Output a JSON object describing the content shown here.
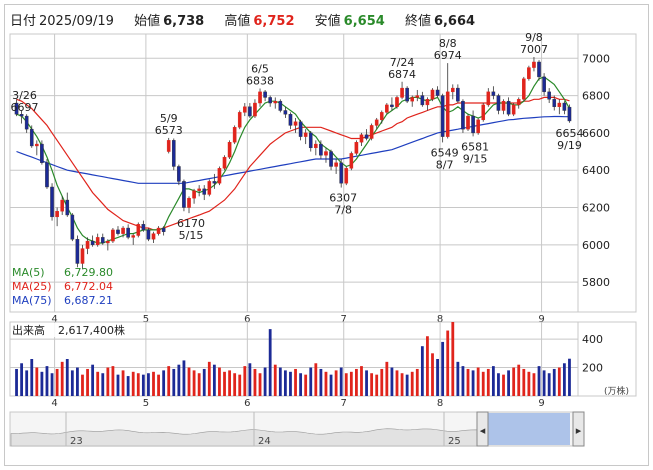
{
  "header": {
    "date_label": "日付",
    "date": "2025/09/19",
    "open_label": "始値",
    "open": "6,738",
    "high_label": "高値",
    "high": "6,752",
    "low_label": "安値",
    "low": "6,654",
    "close_label": "終値",
    "close": "6,664"
  },
  "colors": {
    "up": "#e0241c",
    "down": "#1c2a96",
    "ma5": "#2a8a2a",
    "ma25": "#e0241c",
    "ma75": "#1f3fbf",
    "grid": "#c8c8c8",
    "volume_up": "#e0241c",
    "volume_down": "#1c2a96",
    "navigator_fill": "#9bb7e6"
  },
  "chart_data": [
    {
      "type": "candlestick",
      "y_ticks": [
        5800,
        6000,
        6200,
        6400,
        6600,
        6800,
        7000
      ],
      "ylim": [
        5640,
        7130
      ],
      "month_labels": [
        "4",
        "5",
        "6",
        "7",
        "8",
        "9"
      ],
      "legend": [
        {
          "name": "MA(5)",
          "value": "6,729.80"
        },
        {
          "name": "MA(25)",
          "value": "6,772.04"
        },
        {
          "name": "MA(75)",
          "value": "6,687.21"
        }
      ],
      "annotations": [
        {
          "date": "3/26",
          "value": "6697",
          "kind": "high"
        },
        {
          "date": "5/9",
          "value": "6573",
          "kind": "high"
        },
        {
          "date": "6/5",
          "value": "6838",
          "kind": "high"
        },
        {
          "date": "7/24",
          "value": "6874",
          "kind": "high"
        },
        {
          "date": "8/8",
          "value": "6974",
          "kind": "high"
        },
        {
          "date": "9/8",
          "value": "7007",
          "kind": "high"
        },
        {
          "date": "5/15",
          "value": "6170",
          "kind": "low"
        },
        {
          "date": "7/8",
          "value": "6307",
          "kind": "low"
        },
        {
          "date": "8/7",
          "value": "6549",
          "kind": "low"
        },
        {
          "date": "9/15",
          "value": "6581",
          "kind": "low"
        },
        {
          "date": "9/19",
          "value": "6654",
          "kind": "low"
        }
      ],
      "ohlc": [
        [
          6760,
          6780,
          6690,
          6700
        ],
        [
          6700,
          6720,
          6650,
          6690
        ],
        [
          6690,
          6700,
          6600,
          6620
        ],
        [
          6620,
          6640,
          6520,
          6530
        ],
        [
          6530,
          6560,
          6480,
          6540
        ],
        [
          6540,
          6560,
          6430,
          6440
        ],
        [
          6440,
          6460,
          6300,
          6310
        ],
        [
          6310,
          6330,
          6130,
          6150
        ],
        [
          6150,
          6200,
          6100,
          6180
        ],
        [
          6180,
          6260,
          6160,
          6240
        ],
        [
          6240,
          6280,
          6150,
          6160
        ],
        [
          6160,
          6170,
          6020,
          6030
        ],
        [
          6030,
          6050,
          5880,
          5900
        ],
        [
          5900,
          6000,
          5870,
          5980
        ],
        [
          5980,
          6040,
          5950,
          6020
        ],
        [
          6020,
          6050,
          5990,
          6000
        ],
        [
          6000,
          6060,
          5990,
          6040
        ],
        [
          6040,
          6060,
          6000,
          6010
        ],
        [
          6010,
          6030,
          5970,
          6020
        ],
        [
          6020,
          6090,
          6010,
          6080
        ],
        [
          6080,
          6100,
          6050,
          6060
        ],
        [
          6060,
          6100,
          6040,
          6090
        ],
        [
          6090,
          6110,
          6030,
          6040
        ],
        [
          6040,
          6060,
          6000,
          6050
        ],
        [
          6050,
          6120,
          6040,
          6110
        ],
        [
          6110,
          6130,
          6070,
          6080
        ],
        [
          6080,
          6090,
          6020,
          6030
        ],
        [
          6030,
          6070,
          6010,
          6060
        ],
        [
          6060,
          6100,
          6050,
          6090
        ],
        [
          6090,
          6100,
          6050,
          6070
        ],
        [
          6500,
          6573,
          6490,
          6560
        ],
        [
          6560,
          6570,
          6400,
          6420
        ],
        [
          6420,
          6430,
          6320,
          6340
        ],
        [
          6340,
          6350,
          6180,
          6200
        ],
        [
          6200,
          6260,
          6170,
          6250
        ],
        [
          6250,
          6300,
          6220,
          6290
        ],
        [
          6290,
          6320,
          6260,
          6300
        ],
        [
          6300,
          6320,
          6240,
          6270
        ],
        [
          6270,
          6350,
          6260,
          6340
        ],
        [
          6340,
          6380,
          6300,
          6330
        ],
        [
          6330,
          6420,
          6320,
          6410
        ],
        [
          6410,
          6480,
          6400,
          6470
        ],
        [
          6470,
          6560,
          6460,
          6550
        ],
        [
          6550,
          6640,
          6540,
          6630
        ],
        [
          6630,
          6720,
          6620,
          6710
        ],
        [
          6710,
          6760,
          6690,
          6740
        ],
        [
          6740,
          6760,
          6680,
          6690
        ],
        [
          6690,
          6780,
          6680,
          6760
        ],
        [
          6760,
          6838,
          6740,
          6820
        ],
        [
          6820,
          6830,
          6770,
          6790
        ],
        [
          6790,
          6800,
          6740,
          6760
        ],
        [
          6760,
          6790,
          6730,
          6770
        ],
        [
          6770,
          6780,
          6710,
          6720
        ],
        [
          6720,
          6740,
          6680,
          6700
        ],
        [
          6700,
          6710,
          6620,
          6640
        ],
        [
          6640,
          6680,
          6600,
          6660
        ],
        [
          6660,
          6670,
          6560,
          6580
        ],
        [
          6580,
          6620,
          6540,
          6600
        ],
        [
          6600,
          6610,
          6500,
          6520
        ],
        [
          6520,
          6560,
          6480,
          6540
        ],
        [
          6540,
          6560,
          6460,
          6480
        ],
        [
          6480,
          6520,
          6440,
          6500
        ],
        [
          6500,
          6510,
          6400,
          6420
        ],
        [
          6420,
          6460,
          6380,
          6440
        ],
        [
          6440,
          6460,
          6307,
          6330
        ],
        [
          6330,
          6420,
          6320,
          6410
        ],
        [
          6410,
          6500,
          6400,
          6490
        ],
        [
          6490,
          6560,
          6480,
          6550
        ],
        [
          6550,
          6600,
          6530,
          6590
        ],
        [
          6590,
          6620,
          6560,
          6570
        ],
        [
          6570,
          6650,
          6560,
          6640
        ],
        [
          6640,
          6680,
          6620,
          6670
        ],
        [
          6670,
          6720,
          6650,
          6710
        ],
        [
          6710,
          6760,
          6700,
          6750
        ],
        [
          6750,
          6790,
          6720,
          6740
        ],
        [
          6740,
          6800,
          6730,
          6790
        ],
        [
          6790,
          6874,
          6780,
          6840
        ],
        [
          6840,
          6850,
          6760,
          6770
        ],
        [
          6770,
          6800,
          6740,
          6790
        ],
        [
          6790,
          6830,
          6770,
          6800
        ],
        [
          6800,
          6820,
          6740,
          6750
        ],
        [
          6750,
          6790,
          6720,
          6780
        ],
        [
          6780,
          6840,
          6770,
          6830
        ],
        [
          6830,
          6850,
          6790,
          6800
        ],
        [
          6800,
          6810,
          6549,
          6580
        ],
        [
          6580,
          6974,
          6570,
          6820
        ],
        [
          6820,
          6860,
          6780,
          6840
        ],
        [
          6840,
          6860,
          6760,
          6770
        ],
        [
          6770,
          6780,
          6600,
          6620
        ],
        [
          6620,
          6700,
          6610,
          6690
        ],
        [
          6690,
          6720,
          6581,
          6600
        ],
        [
          6600,
          6680,
          6590,
          6670
        ],
        [
          6670,
          6760,
          6660,
          6750
        ],
        [
          6750,
          6840,
          6740,
          6820
        ],
        [
          6820,
          6850,
          6780,
          6800
        ],
        [
          6800,
          6810,
          6700,
          6720
        ],
        [
          6720,
          6780,
          6700,
          6770
        ],
        [
          6770,
          6790,
          6690,
          6700
        ],
        [
          6700,
          6760,
          6690,
          6750
        ],
        [
          6750,
          6790,
          6730,
          6780
        ],
        [
          6780,
          6900,
          6770,
          6890
        ],
        [
          6890,
          6960,
          6880,
          6950
        ],
        [
          6950,
          7007,
          6930,
          6980
        ],
        [
          6980,
          6990,
          6880,
          6900
        ],
        [
          6900,
          6920,
          6800,
          6820
        ],
        [
          6820,
          6840,
          6760,
          6780
        ],
        [
          6780,
          6800,
          6720,
          6740
        ],
        [
          6740,
          6780,
          6700,
          6760
        ],
        [
          6760,
          6770,
          6700,
          6720
        ],
        [
          6738,
          6752,
          6654,
          6664
        ]
      ],
      "ma5": [
        6700,
        6690,
        6660,
        6620,
        6580,
        6530,
        6470,
        6400,
        6320,
        6260,
        6200,
        6150,
        6090,
        6050,
        6030,
        6020,
        6010,
        6010,
        6020,
        6030,
        6040,
        6050,
        6060,
        6060,
        6070,
        6080,
        6080,
        6080,
        6080,
        6090,
        6150,
        6200,
        6250,
        6300,
        6300,
        6290,
        6280,
        6290,
        6300,
        6320,
        6350,
        6390,
        6440,
        6500,
        6570,
        6630,
        6670,
        6700,
        6730,
        6760,
        6770,
        6770,
        6760,
        6740,
        6720,
        6700,
        6660,
        6630,
        6600,
        6580,
        6540,
        6520,
        6500,
        6470,
        6440,
        6420,
        6430,
        6460,
        6500,
        6540,
        6580,
        6620,
        6660,
        6700,
        6720,
        6740,
        6770,
        6780,
        6790,
        6790,
        6780,
        6770,
        6780,
        6790,
        6740,
        6710,
        6720,
        6740,
        6720,
        6700,
        6690,
        6680,
        6690,
        6720,
        6750,
        6760,
        6760,
        6760,
        6750,
        6750,
        6770,
        6800,
        6850,
        6890,
        6900,
        6880,
        6860,
        6820,
        6780,
        6730
      ],
      "ma25": [
        6780,
        6770,
        6750,
        6730,
        6700,
        6670,
        6640,
        6600,
        6560,
        6520,
        6480,
        6440,
        6400,
        6360,
        6320,
        6280,
        6250,
        6220,
        6190,
        6170,
        6150,
        6130,
        6120,
        6110,
        6100,
        6090,
        6090,
        6080,
        6080,
        6090,
        6100,
        6110,
        6120,
        6130,
        6140,
        6150,
        6160,
        6170,
        6180,
        6200,
        6220,
        6240,
        6270,
        6300,
        6340,
        6380,
        6420,
        6450,
        6480,
        6510,
        6540,
        6560,
        6580,
        6600,
        6610,
        6620,
        6630,
        6630,
        6630,
        6630,
        6630,
        6620,
        6610,
        6600,
        6590,
        6580,
        6570,
        6570,
        6570,
        6580,
        6590,
        6600,
        6610,
        6620,
        6630,
        6650,
        6660,
        6680,
        6690,
        6700,
        6710,
        6720,
        6730,
        6740,
        6740,
        6750,
        6750,
        6760,
        6760,
        6760,
        6760,
        6760,
        6760,
        6760,
        6760,
        6760,
        6760,
        6760,
        6760,
        6760,
        6770,
        6770,
        6780,
        6780,
        6790,
        6790,
        6790,
        6780,
        6780,
        6772
      ],
      "ma75": [
        6500,
        6490,
        6480,
        6470,
        6460,
        6450,
        6440,
        6430,
        6420,
        6410,
        6400,
        6395,
        6390,
        6385,
        6380,
        6375,
        6370,
        6365,
        6360,
        6355,
        6350,
        6345,
        6340,
        6335,
        6330,
        6330,
        6330,
        6330,
        6330,
        6330,
        6330,
        6330,
        6330,
        6330,
        6335,
        6340,
        6345,
        6350,
        6355,
        6360,
        6365,
        6370,
        6375,
        6380,
        6385,
        6390,
        6395,
        6400,
        6405,
        6410,
        6415,
        6420,
        6425,
        6430,
        6435,
        6440,
        6445,
        6450,
        6455,
        6460,
        6460,
        6460,
        6460,
        6460,
        6460,
        6465,
        6470,
        6475,
        6480,
        6485,
        6490,
        6495,
        6500,
        6505,
        6510,
        6520,
        6530,
        6540,
        6550,
        6560,
        6570,
        6580,
        6590,
        6600,
        6605,
        6610,
        6615,
        6620,
        6625,
        6630,
        6635,
        6640,
        6645,
        6650,
        6655,
        6660,
        6665,
        6670,
        6672,
        6675,
        6678,
        6680,
        6682,
        6684,
        6686,
        6687,
        6688,
        6688,
        6687,
        6687
      ]
    },
    {
      "type": "bar",
      "title": "出来高",
      "value_text": "2,617,400株",
      "unit": "(万株)",
      "y_ticks": [
        200,
        400
      ],
      "ylim": [
        0,
        520
      ],
      "values": [
        190,
        230,
        180,
        260,
        200,
        170,
        210,
        160,
        190,
        240,
        260,
        180,
        200,
        150,
        190,
        220,
        170,
        160,
        200,
        210,
        150,
        180,
        140,
        170,
        160,
        150,
        160,
        170,
        150,
        180,
        210,
        190,
        220,
        250,
        200,
        180,
        160,
        190,
        240,
        220,
        200,
        170,
        180,
        160,
        150,
        210,
        230,
        190,
        160,
        200,
        470,
        220,
        200,
        180,
        170,
        190,
        160,
        150,
        200,
        230,
        190,
        170,
        150,
        180,
        200,
        160,
        170,
        190,
        210,
        180,
        160,
        150,
        190,
        240,
        200,
        180,
        160,
        150,
        170,
        190,
        350,
        420,
        300,
        260,
        380,
        460,
        520,
        240,
        210,
        190,
        180,
        200,
        170,
        190,
        210,
        160,
        150,
        180,
        200,
        220,
        190,
        170,
        160,
        210,
        180,
        160,
        190,
        200,
        230,
        262
      ]
    },
    {
      "type": "navigator",
      "year_labels": [
        "23",
        "24",
        "25"
      ]
    }
  ]
}
